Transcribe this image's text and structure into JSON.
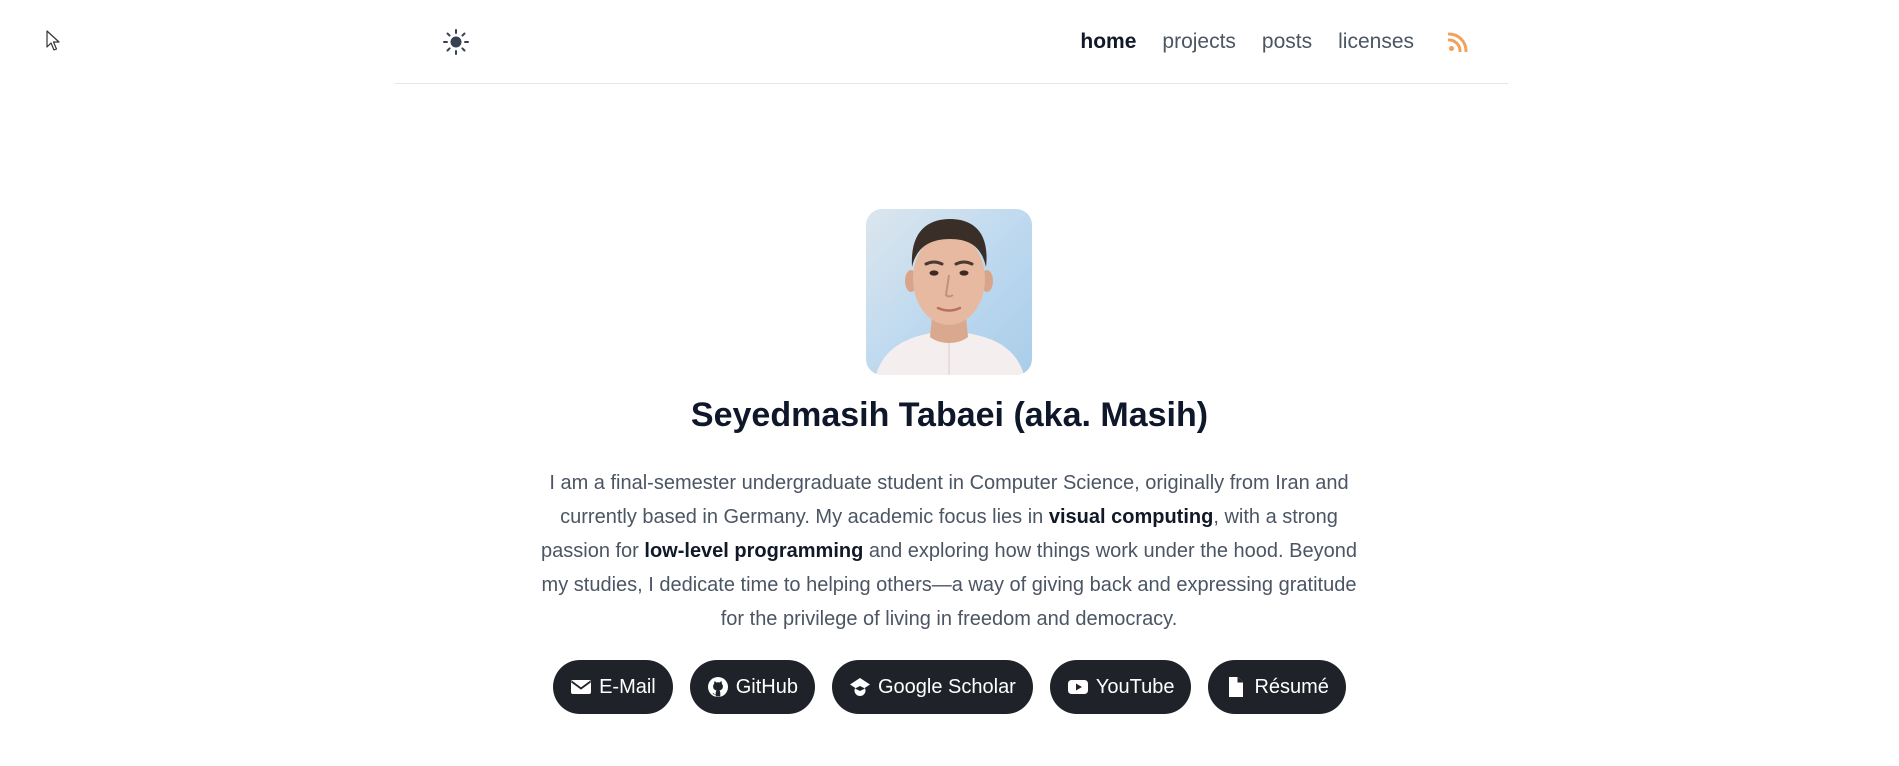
{
  "header": {
    "theme_toggle_icon": "sun-icon",
    "nav": [
      {
        "label": "home",
        "active": true
      },
      {
        "label": "projects",
        "active": false
      },
      {
        "label": "posts",
        "active": false
      },
      {
        "label": "licenses",
        "active": false
      }
    ],
    "rss_icon": "rss-icon",
    "rss_color": "#f0a15c"
  },
  "profile": {
    "avatar": "profile-photo",
    "name": "Seyedmasih Tabaei (aka. Masih)",
    "bio": {
      "part1": "I am a final-semester undergraduate student in Computer Science, originally from Iran and currently based in Germany. My academic focus lies in ",
      "bold1": "visual computing",
      "part2": ", with a strong passion for ",
      "bold2": "low-level programming",
      "part3": " and exploring how things work under the hood. Beyond my studies, I dedicate time to helping others—a way of giving back and expressing gratitude for the privilege of living in freedom and democracy."
    }
  },
  "links": [
    {
      "label": "E-Mail",
      "icon": "envelope-icon"
    },
    {
      "label": "GitHub",
      "icon": "github-icon"
    },
    {
      "label": "Google Scholar",
      "icon": "graduation-cap-icon"
    },
    {
      "label": "YouTube",
      "icon": "youtube-icon"
    },
    {
      "label": "Résumé",
      "icon": "file-icon"
    }
  ],
  "colors": {
    "button_bg": "#1f2329",
    "heading": "#0f172a",
    "text": "#4b5563"
  }
}
